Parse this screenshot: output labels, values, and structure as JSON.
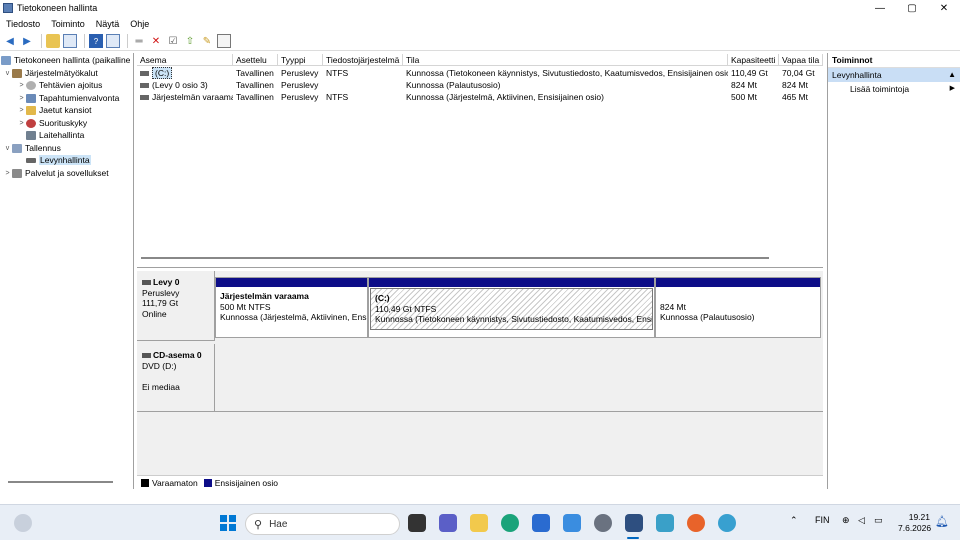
{
  "window": {
    "title": "Tietokoneen hallinta",
    "min": "—",
    "max": "▢",
    "close": "✕"
  },
  "menu": [
    "Tiedosto",
    "Toiminto",
    "Näytä",
    "Ohje"
  ],
  "tree": [
    {
      "label": "Tietokoneen hallinta (paikalline",
      "exp": ""
    },
    {
      "label": "Järjestelmätyökalut",
      "exp": "v"
    },
    {
      "label": "Tehtävien ajoitus",
      "exp": ">"
    },
    {
      "label": "Tapahtumienvalvonta",
      "exp": ">"
    },
    {
      "label": "Jaetut kansiot",
      "exp": ">"
    },
    {
      "label": "Suorituskyky",
      "exp": ">"
    },
    {
      "label": "Laitehallinta",
      "exp": ""
    },
    {
      "label": "Tallennus",
      "exp": "v"
    },
    {
      "label": "Levynhallinta",
      "exp": ""
    },
    {
      "label": "Palvelut ja sovellukset",
      "exp": ">"
    }
  ],
  "volumes": {
    "headers": [
      "Asema",
      "Asettelu",
      "Tyyppi",
      "Tiedostojärjestelmä",
      "Tila",
      "Kapasiteetti",
      "Vapaa tila"
    ],
    "rows": [
      [
        "(C:)",
        "Tavallinen",
        "Peruslevy",
        "NTFS",
        "Kunnossa (Tietokoneen käynnistys, Sivutustiedosto, Kaatumisvedos, Ensisijainen osio)",
        "110,49 Gt",
        "70,04 Gt"
      ],
      [
        "(Levy 0 osio 3)",
        "Tavallinen",
        "Peruslevy",
        "",
        "Kunnossa (Palautusosio)",
        "824 Mt",
        "824 Mt"
      ],
      [
        "Järjestelmän varaama",
        "Tavallinen",
        "Peruslevy",
        "NTFS",
        "Kunnossa (Järjestelmä, Aktiivinen, Ensisijainen osio)",
        "500 Mt",
        "465 Mt"
      ]
    ]
  },
  "disks": [
    {
      "name": "Levy 0",
      "type": "Peruslevy",
      "size": "111,79 Gt",
      "status": "Online"
    },
    {
      "name": "CD-asema 0",
      "type": "DVD (D:)",
      "size": "",
      "status": "Ei mediaa"
    }
  ],
  "partitions": [
    {
      "name": "Järjestelmän varaama",
      "size": "500 Mt NTFS",
      "status": "Kunnossa (Järjestelmä, Aktiivinen, Ensisi"
    },
    {
      "name": "(C:)",
      "size": "110,49 Gt NTFS",
      "status": "Kunnossa (Tietokoneen käynnistys, Sivutustiedosto, Kaatumisvedos, Ensisij"
    },
    {
      "name": "",
      "size": "824 Mt",
      "status": "Kunnossa (Palautusosio)"
    }
  ],
  "legend": [
    {
      "label": "Varaamaton",
      "color": "#000000"
    },
    {
      "label": "Ensisijainen osio",
      "color": "#0d0d88"
    }
  ],
  "actions": {
    "header": "Toiminnot",
    "section": "Levynhallinta",
    "item": "Lisää toimintoja"
  },
  "taskbar": {
    "search_placeholder": "Hae",
    "lang": "FIN",
    "time": "19.21",
    "date": "7.6.2026"
  }
}
